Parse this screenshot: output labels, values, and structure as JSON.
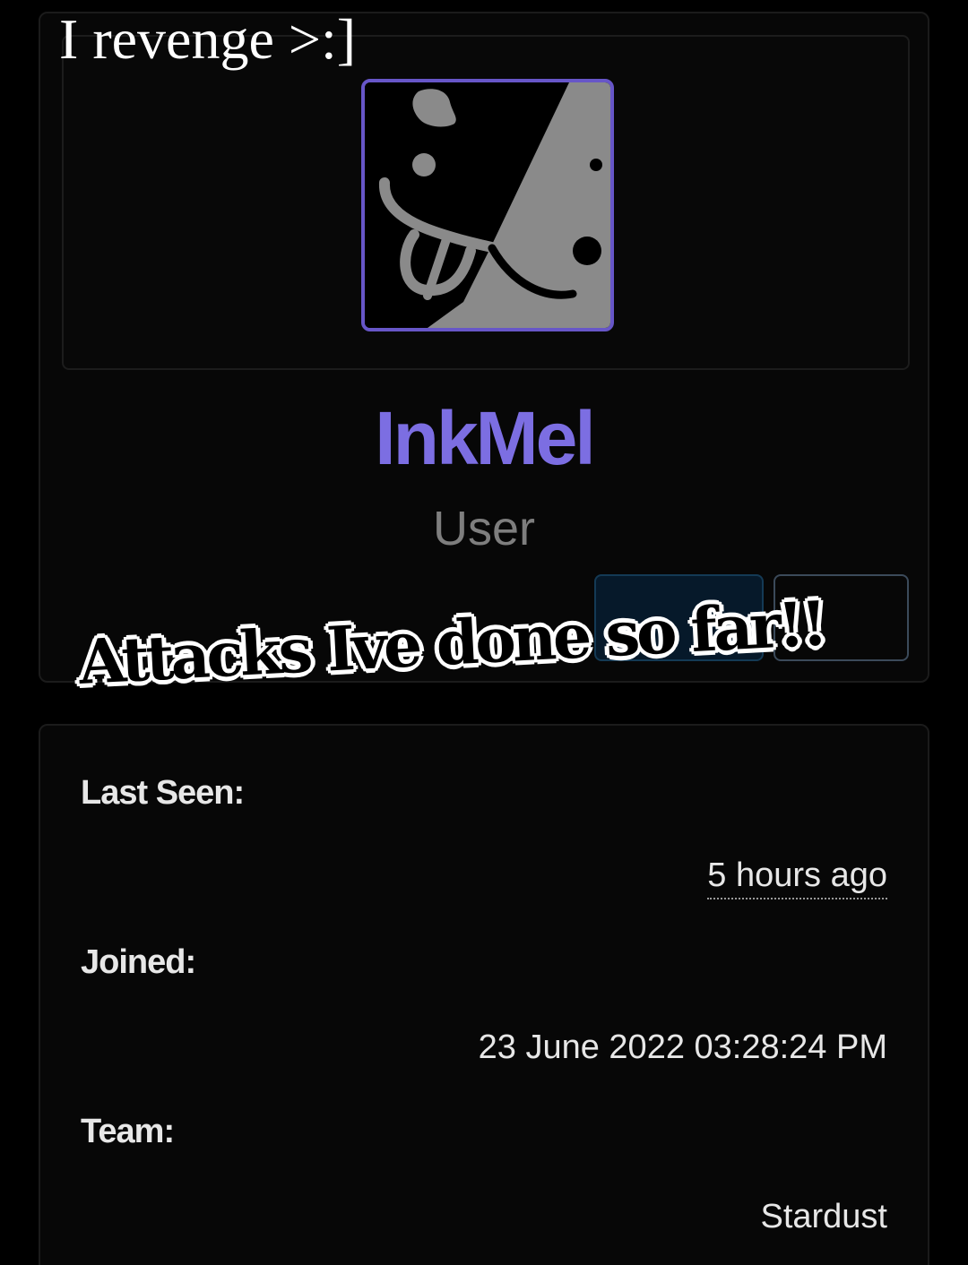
{
  "overlay": {
    "top_caption": "I revenge >:]",
    "main_caption": "Attacks Ive done so far!!"
  },
  "profile": {
    "username": "InkMel",
    "role": "User",
    "avatar_icon": "ink-character-avatar",
    "colors": {
      "accent": "#7c6ee2",
      "avatar_border": "#6756c8",
      "role_text": "#7e7e7e",
      "background": "#000000",
      "card": "#070707"
    }
  },
  "details": {
    "last_seen": {
      "label": "Last Seen:",
      "value": "5 hours ago"
    },
    "joined": {
      "label": "Joined:",
      "value": "23 June 2022 03:28:24 PM"
    },
    "team": {
      "label": "Team:",
      "value": "Stardust"
    }
  }
}
